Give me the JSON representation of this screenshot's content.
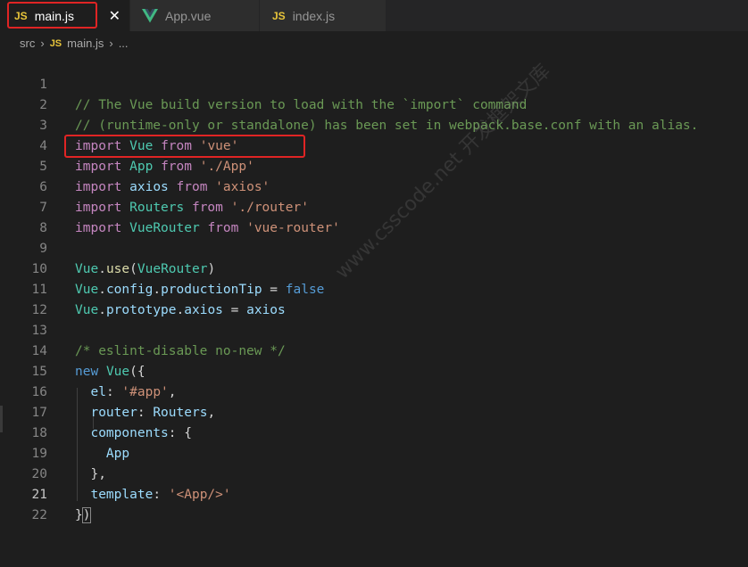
{
  "tabs": [
    {
      "icon": "JS",
      "label": "main.js",
      "active": true,
      "close": "✕"
    },
    {
      "icon": "vue-icon",
      "label": "App.vue",
      "active": false
    },
    {
      "icon": "JS",
      "label": "index.js",
      "active": false
    }
  ],
  "breadcrumb": {
    "folder": "src",
    "icon": "JS",
    "file": "main.js",
    "more": "..."
  },
  "colors": {
    "highlight": "#e02424",
    "js_icon": "#e8c53a",
    "vue_green": "#41b883"
  },
  "watermark": "www.csscode.net 开发框架文库",
  "current_line": "21",
  "code_lines": [
    {
      "n": "1",
      "text": "// The Vue build version to load with the `import` command"
    },
    {
      "n": "2",
      "text": "// (runtime-only or standalone) has been set in webpack.base.conf with an alias."
    },
    {
      "n": "3",
      "text": "import Vue from 'vue'"
    },
    {
      "n": "4",
      "text": "import App from './App'"
    },
    {
      "n": "5",
      "text": "import axios from 'axios'"
    },
    {
      "n": "6",
      "text": "import Routers from './router'"
    },
    {
      "n": "7",
      "text": "import VueRouter from 'vue-router'"
    },
    {
      "n": "8",
      "text": ""
    },
    {
      "n": "9",
      "text": "Vue.use(VueRouter)"
    },
    {
      "n": "10",
      "text": "Vue.config.productionTip = false"
    },
    {
      "n": "11",
      "text": "Vue.prototype.axios = axios"
    },
    {
      "n": "12",
      "text": ""
    },
    {
      "n": "13",
      "text": "/* eslint-disable no-new */"
    },
    {
      "n": "14",
      "text": "new Vue({"
    },
    {
      "n": "15",
      "text": "  el: '#app',"
    },
    {
      "n": "16",
      "text": "  router: Routers,"
    },
    {
      "n": "17",
      "text": "  components: {"
    },
    {
      "n": "18",
      "text": "    App"
    },
    {
      "n": "19",
      "text": "  },"
    },
    {
      "n": "20",
      "text": "  template: '<App/>'"
    },
    {
      "n": "21",
      "text": "})"
    },
    {
      "n": "22",
      "text": ""
    }
  ]
}
